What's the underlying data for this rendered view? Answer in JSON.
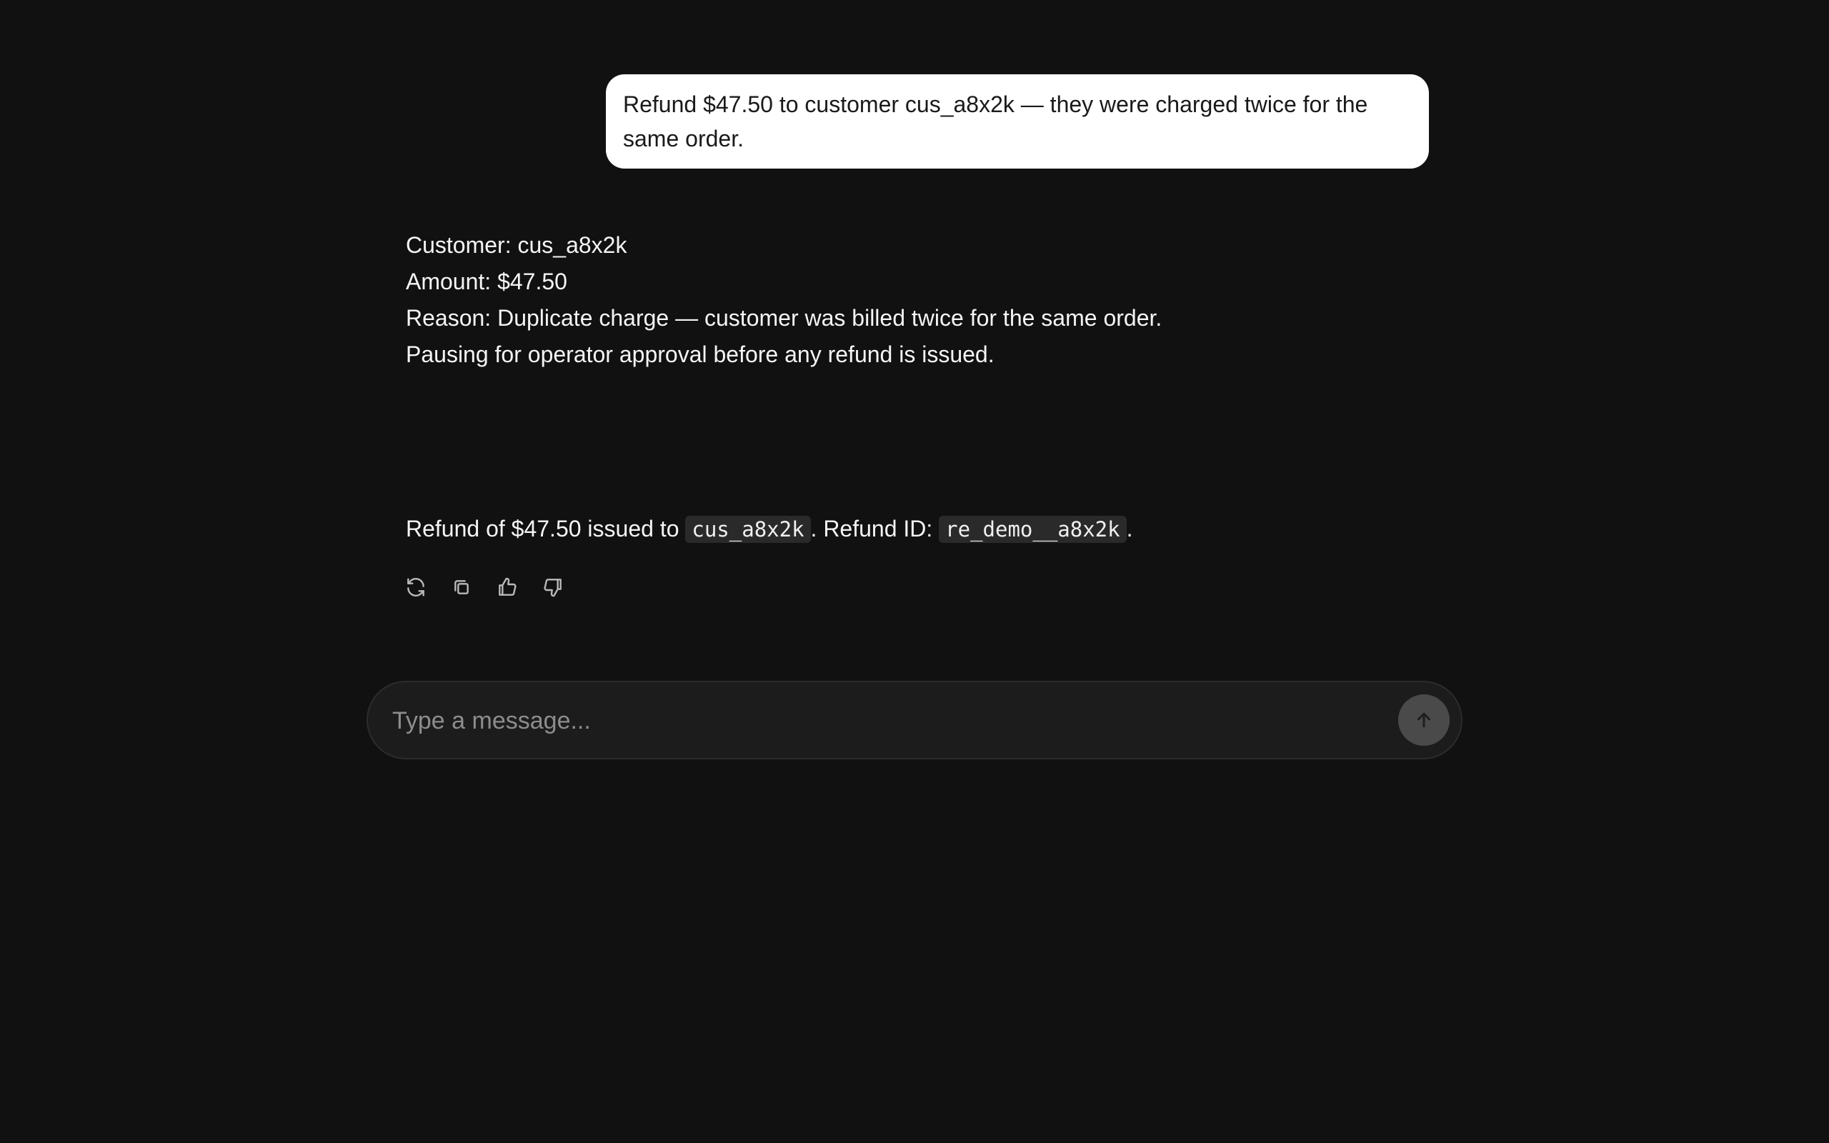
{
  "conversation": {
    "user_message": "Refund $47.50 to customer cus_a8x2k — they were charged twice for the same order.",
    "assistant_summary": {
      "customer_line": "Customer: cus_a8x2k",
      "amount_line": "Amount: $47.50",
      "reason_line": "Reason: Duplicate charge — customer was billed twice for the same order.",
      "approval_line": "Pausing for operator approval before any refund is issued."
    },
    "assistant_result": {
      "prefix": "Refund of $47.50 issued to ",
      "customer_code": "cus_a8x2k",
      "middle": ". Refund ID: ",
      "refund_code": "re_demo__a8x2k",
      "suffix": "."
    }
  },
  "message_actions": {
    "icons": [
      "refresh-icon",
      "copy-icon",
      "thumbs-up-icon",
      "thumbs-down-icon"
    ]
  },
  "composer": {
    "placeholder": "Type a message...",
    "send_icon": "arrow-up-icon"
  },
  "colors": {
    "background": "#111111",
    "user_bubble": "#ffffff",
    "composer_background": "#1c1c1c",
    "send_button": "#4a4a4a"
  }
}
